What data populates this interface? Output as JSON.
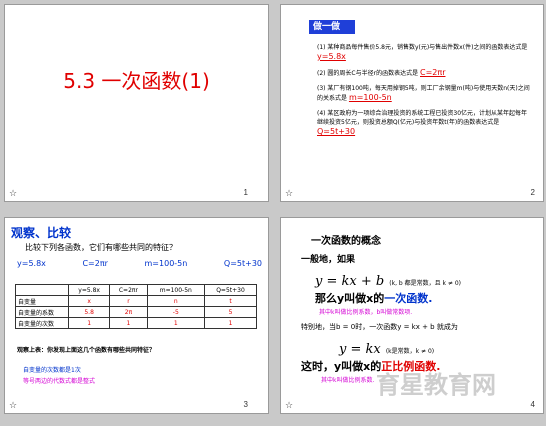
{
  "slides": [
    {
      "number": "1",
      "title": "5.3 一次函数(1)"
    },
    {
      "number": "2",
      "header": "做一做",
      "items": [
        {
          "text": "(1) 某种商品每件售价5.8元，销售数y(元)与售出件数x(件)之间的函数表达式是",
          "answer": "y=5.8x"
        },
        {
          "text": "(2) 圆的周长C与半径r的函数表达式是",
          "answer": "C=2πr"
        },
        {
          "text": "(3) 某厂有钢100吨，每天用掉钢5吨，则工厂余钢量m(吨)与使用天数n(天)之间的关系式是",
          "answer": "m=100-5n"
        },
        {
          "text": "(4) 某区政府为一项综合治理投资的系统工程已投资30亿元，计划从某年起每年继续投资5亿元，则投资总额Q(亿元)与投资年数t(年)的函数表达式是",
          "answer": "Q=5t+30"
        }
      ]
    },
    {
      "number": "3",
      "title": "观察、比较",
      "prompt": "比较下列各函数，它们有哪些共同的特征？",
      "formulas": [
        "y=5.8x",
        "C=2πr",
        "m=100-5n",
        "Q=5t+30"
      ],
      "table": {
        "header": [
          "",
          "y=5.8x",
          "C=2πr",
          "m=100-5n",
          "Q=5t+30"
        ],
        "rows": [
          [
            "自变量",
            "x",
            "r",
            "n",
            "t"
          ],
          [
            "自变量的系数",
            "5.8",
            "2π",
            "-5",
            "5"
          ],
          [
            "自变量的次数",
            "1",
            "1",
            "1",
            "1"
          ]
        ]
      },
      "question": "观察上表：你发现上面这几个函数有哪些共同特征？",
      "note1": "自变量的次数都是1次",
      "note2": "等号两边的代数式都是整式"
    },
    {
      "number": "4",
      "title": "一次函数的概念",
      "intro": "一般地，如果",
      "formula1": "y = kx + b",
      "cond1": "(k, b 都是常数，且 k ≠ 0)",
      "then1": "那么y叫做x的",
      "term1": "一次函数.",
      "coef1": "其中k叫做比例系数，b叫做常数项.",
      "special": "特别地，当b = 0时，一次函数y = kx + b 就成为",
      "formula2": "y = kx",
      "cond2": "(k是常数，k ≠ 0)",
      "then2": "这时，y叫做x的",
      "term2": "正比例函数.",
      "coef2": "其中k叫做比例系数.",
      "watermark": "育星教育网"
    }
  ]
}
